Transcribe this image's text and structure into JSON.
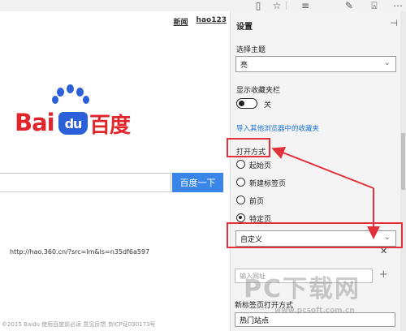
{
  "toolbar": {
    "reading_icon": "reading-view-icon",
    "favorite_icon": "star-icon",
    "hub_icon": "hub-lines-icon",
    "note_icon": "web-note-icon",
    "share_icon": "share-icon",
    "more_icon": "ellipsis-icon"
  },
  "page": {
    "nav": [
      "新闻",
      "hao123"
    ],
    "logo_bai": "Bai",
    "logo_du": "du",
    "logo_cn": "百度",
    "search_button": "百度一下",
    "footer": "©2015 Baidu 使用百度前必读 意见反馈 京ICP证030173号"
  },
  "settings": {
    "title": "设置",
    "theme_label": "选择主题",
    "theme_value": "亮",
    "fav_bar_label": "显示收藏夹栏",
    "fav_bar_state": "关",
    "import_link": "导入其他浏览器中的收藏夹",
    "open_with_label": "打开方式",
    "radios": [
      {
        "label": "起始页",
        "selected": false
      },
      {
        "label": "新建标签页",
        "selected": false
      },
      {
        "label": "前页",
        "selected": false
      },
      {
        "label": "特定页",
        "selected": true
      }
    ],
    "custom_select": "自定义",
    "url": "http://hao.360.cn/?src=lm&ls=n35df6a597",
    "input_placeholder": "输入网址",
    "newtab_label": "新标签页打开方式",
    "newtab_value": "热门站点"
  },
  "watermark": {
    "text": "PC下载网",
    "sub": "www.pcsoft.com.cn"
  },
  "colors": {
    "annotation_red": "#e4303a",
    "baidu_red": "#e0262b",
    "baidu_blue": "#2b60d8",
    "link_blue": "#1a72d8",
    "search_blue": "#3a86e8"
  }
}
